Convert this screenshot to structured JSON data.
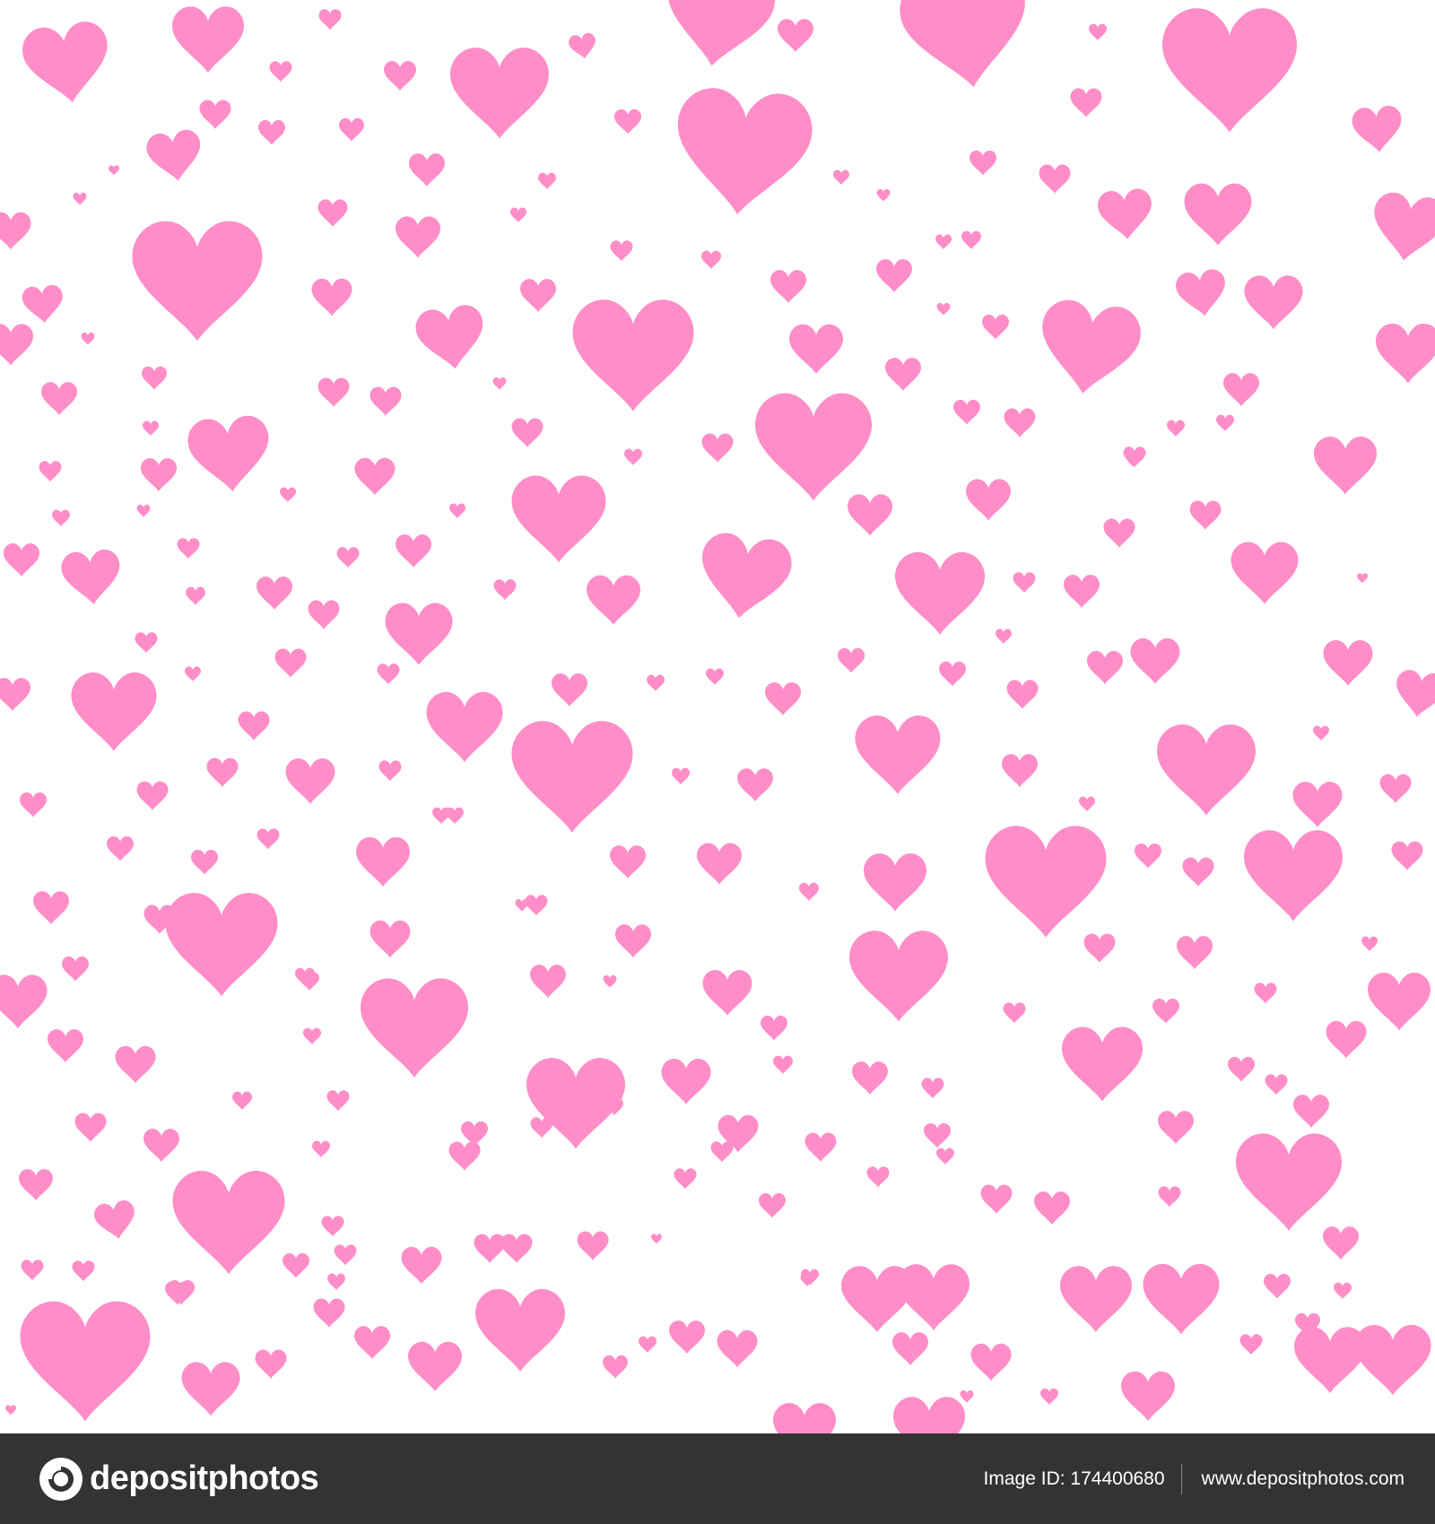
{
  "heart_color": "#FF8EC8",
  "background_color": "#FFFFFF",
  "footer": {
    "background_color": "#333333",
    "brand_name": "depositphotos",
    "image_id_label": "Image ID:",
    "image_id_value": "174400680",
    "website": "www.depositphotos.com",
    "logo_icon": "camera-lens-logo-icon"
  }
}
